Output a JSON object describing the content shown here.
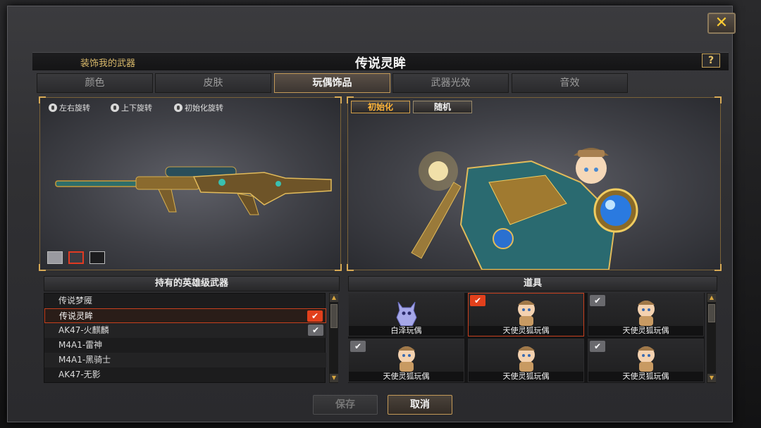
{
  "dialog": {
    "subtitle": "装饰我的武器",
    "title": "传说灵眸",
    "help_label": "?",
    "close_label": "✕"
  },
  "tabs": [
    {
      "label": "颜色",
      "active": false
    },
    {
      "label": "皮肤",
      "active": false
    },
    {
      "label": "玩偶饰品",
      "active": true
    },
    {
      "label": "武器光效",
      "active": false
    },
    {
      "label": "音效",
      "active": false
    }
  ],
  "preview_controls": {
    "rotate_lr": "左右旋转",
    "rotate_ud": "上下旋转",
    "reset_rotation": "初始化旋转"
  },
  "swatches": [
    {
      "color": "#9a9aa0",
      "selected": false
    },
    {
      "color": "#3b3c42",
      "selected": true
    },
    {
      "color": "#1c1c1e",
      "selected": false
    }
  ],
  "doll_preview": {
    "reset_label": "初始化",
    "random_label": "随机"
  },
  "weapon_list": {
    "header": "持有的英雄级武器",
    "items": [
      {
        "name": "传说梦魇",
        "selected": false,
        "check": "none"
      },
      {
        "name": "传说灵眸",
        "selected": true,
        "check": "red"
      },
      {
        "name": "AK47-火麒麟",
        "selected": false,
        "check": "gray"
      },
      {
        "name": "M4A1-雷神",
        "selected": false,
        "check": "none"
      },
      {
        "name": "M4A1-黑骑士",
        "selected": false,
        "check": "none"
      },
      {
        "name": "AK47-无影",
        "selected": false,
        "check": "none"
      }
    ]
  },
  "items_panel": {
    "header": "道具",
    "items": [
      {
        "name": "白泽玩偶",
        "check": "none",
        "selected": false,
        "kind": "baize"
      },
      {
        "name": "天使灵狐玩偶",
        "check": "red",
        "selected": true,
        "kind": "fox"
      },
      {
        "name": "天使灵狐玩偶",
        "check": "gray",
        "selected": false,
        "kind": "fox"
      },
      {
        "name": "天使灵狐玩偶",
        "check": "gray",
        "selected": false,
        "kind": "fox"
      },
      {
        "name": "天使灵狐玩偶",
        "check": "none",
        "selected": false,
        "kind": "fox"
      },
      {
        "name": "天使灵狐玩偶",
        "check": "gray",
        "selected": false,
        "kind": "fox"
      }
    ]
  },
  "footer": {
    "save_label": "保存",
    "cancel_label": "取消"
  }
}
